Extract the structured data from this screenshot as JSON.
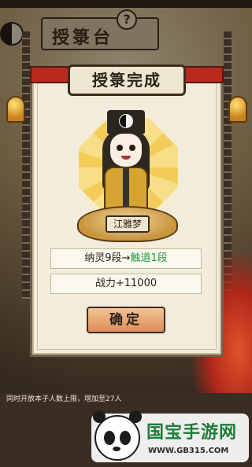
{
  "background": {
    "title": "授箓台",
    "help_icon": "?",
    "footer_text": "同时开放本子人数上限，增加至27人"
  },
  "dialog": {
    "title": "授箓完成",
    "ribbon_left": "",
    "ribbon_right": "",
    "character_name": "江雅梦",
    "promotion": {
      "from": "纳灵9段",
      "arrow": "→",
      "to": "触道1段"
    },
    "power": "战力+11000",
    "confirm_label": "确定"
  },
  "watermark": {
    "title": "国宝手游网",
    "url": "WWW.GB315.COM"
  },
  "colors": {
    "promotion_to": "#1a9b3a",
    "confirm_bg": "#dd8d57",
    "bagua": "#f1c84a"
  },
  "icons": [
    "yin-yang-icon",
    "bell-icon",
    "help-icon",
    "panda-logo-icon"
  ]
}
